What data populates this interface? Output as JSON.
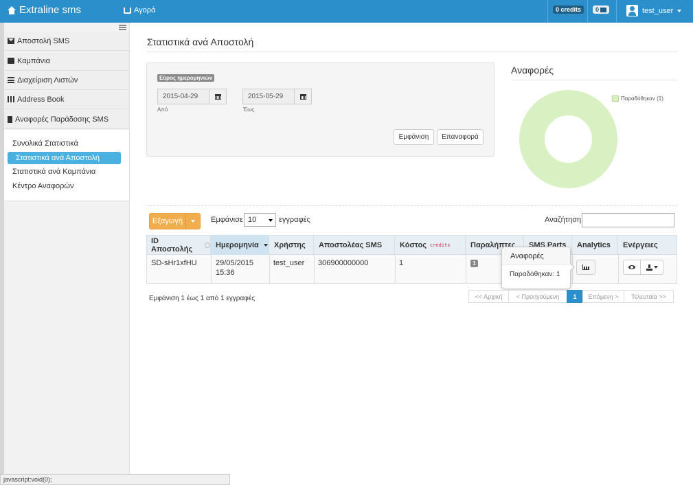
{
  "navbar": {
    "brand": "Extraline sms",
    "shop": "Αγορά",
    "credits": "0 credits",
    "messages_count": "0",
    "user": "test_user"
  },
  "sidebar": {
    "items": [
      {
        "label": "Αποστολή SMS",
        "icon": "envelope-icon"
      },
      {
        "label": "Καμπάνια",
        "icon": "folder-icon"
      },
      {
        "label": "Διαχείριση Λιστών",
        "icon": "list-icon"
      },
      {
        "label": "Address Book",
        "icon": "grid-icon"
      },
      {
        "label": "Αναφορές Παράδοσης SMS",
        "icon": "file-icon"
      }
    ],
    "sub_items": [
      {
        "label": "Συνολικά Στατιστικά"
      },
      {
        "label": "Στατιστικά ανά Αποστολή",
        "active": true
      },
      {
        "label": "Στατιστικά ανά Καμπάνια"
      },
      {
        "label": "Κέντρο Αναφορών"
      }
    ]
  },
  "page": {
    "title": "Στατιστικά ανά Αποστολή"
  },
  "filter": {
    "range_label": "Εύρος ημερομηνιών",
    "from_value": "2015-04-29",
    "from_caption": "Από",
    "to_value": "2015-05-29",
    "to_caption": "Έως",
    "show_button": "Εμφάνιση",
    "reset_button": "Επαναφορά"
  },
  "reports": {
    "title": "Αναφορές",
    "legend": "Παραδόθηκαν (1)",
    "donut_color": "#d9f0c3"
  },
  "table_controls": {
    "export": "Εξαγωγή",
    "show_prefix": "Εμφάνισε",
    "page_length": "10",
    "show_suffix": "εγγραφές",
    "search_label": "Αναζήτηση",
    "search_value": ""
  },
  "table": {
    "headers": [
      "ID Αποστολής",
      "Ημερομηνία",
      "Χρήστης",
      "Αποστολέας SMS",
      "Κόστος",
      "Παραλήπτες",
      "SMS Parts",
      "Analytics",
      "Ενέργειες"
    ],
    "cost_unit": "credits",
    "row": {
      "id": "SD-sHr1xfHU",
      "date_line1": "29/05/2015",
      "date_line2": "15:36",
      "user": "test_user",
      "sender": "306900000000",
      "cost": "1",
      "recipients": "1"
    }
  },
  "popover": {
    "title": "Αναφορές",
    "body": "Παραδόθηκαν: 1"
  },
  "footer": {
    "info": "Εμφάνιση 1 έως 1 από 1 εγγραφές",
    "pager": [
      "<< Αρχική",
      "< Προηγούμενη",
      "1",
      "Επόμενη >",
      "Τελευταία >>"
    ]
  },
  "status_bar": "javascript:void(0);"
}
